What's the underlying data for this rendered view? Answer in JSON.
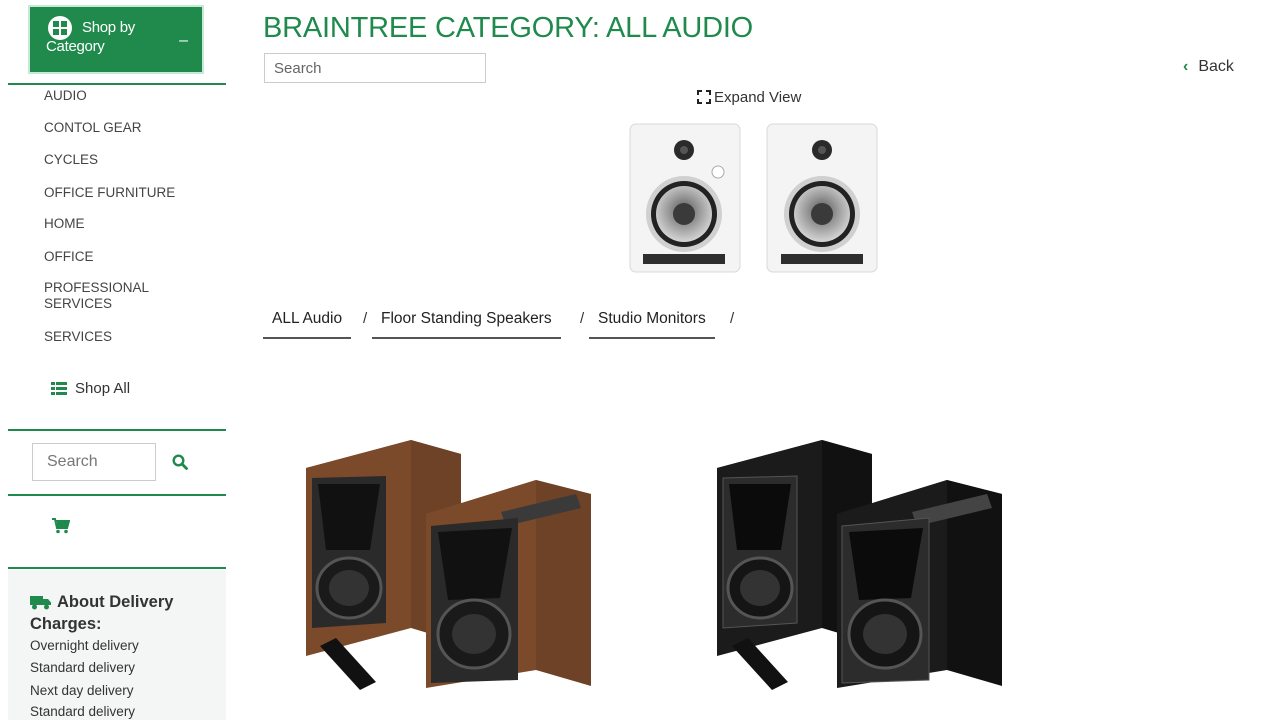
{
  "sidebar": {
    "shop_by_category": "Shop by Category",
    "collapse_symbol": "–",
    "categories": [
      {
        "label": "AUDIO"
      },
      {
        "label": "CONTOL GEAR"
      },
      {
        "label": "CYCLES"
      },
      {
        "label": "OFFICE FURNITURE"
      },
      {
        "label": "HOME"
      },
      {
        "label": "OFFICE"
      },
      {
        "label": "PROFESSIONAL SERVICES"
      },
      {
        "label": "SERVICES"
      }
    ],
    "shop_all": "Shop All",
    "search_placeholder": "Search",
    "delivery": {
      "title": "About Delivery Charges:",
      "lines": [
        "Overnight delivery",
        "Standard delivery",
        "Next day delivery",
        "Standard delivery"
      ]
    }
  },
  "main": {
    "title": "BRAINTREE CATEGORY: ALL AUDIO",
    "search_placeholder": "Search",
    "back_label": "Back",
    "back_icon": "chevron-left-icon",
    "expand_view": "Expand View",
    "breadcrumbs": [
      {
        "label": "ALL Audio"
      },
      {
        "label": "Floor Standing Speakers"
      },
      {
        "label": "Studio Monitors"
      }
    ],
    "separator": "/"
  },
  "colors": {
    "accent": "#1f8a4c",
    "walnut": "#7a4a2a",
    "black_cabinet": "#1b1b1b",
    "monitor_white": "#f2f2f2"
  }
}
